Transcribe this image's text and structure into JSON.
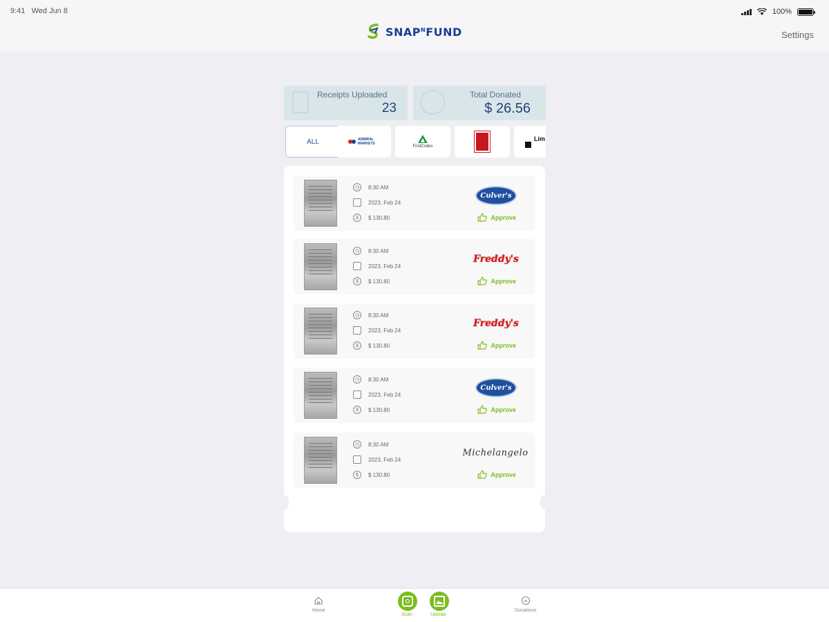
{
  "status_bar": {
    "time": "9:41",
    "date": "Wed Jun 8",
    "battery": "100%"
  },
  "header": {
    "app_name": "SNAP",
    "app_name_small": "N",
    "app_name_end": "FUND",
    "settings_label": "Settings",
    "brand_color": "#1c3f92",
    "accent_color": "#7cbc21"
  },
  "stats": {
    "receipts_label": "Receipts Uploaded",
    "receipts_value": "23",
    "donated_label": "Total Donated",
    "donated_value": "$ 26.56"
  },
  "filters": [
    {
      "label": "ALL",
      "selected": true
    },
    {
      "label": "ADMIRAL MARKETS",
      "icon": "admiral-markets-logo"
    },
    {
      "label": "FirstCodes",
      "icon": "firstcodes-logo"
    },
    {
      "label": "",
      "icon": "red-badge-logo"
    },
    {
      "label": "Lim",
      "icon": "lim-logo"
    }
  ],
  "receipts": [
    {
      "time": "8:30 AM",
      "date": "2023, Feb 24",
      "amount": "$ 130.80",
      "brand": "Culver's",
      "status": "Approve"
    },
    {
      "time": "8:30 AM",
      "date": "2023, Feb 24",
      "amount": "$ 130.80",
      "brand": "Freddy's",
      "status": "Approve"
    },
    {
      "time": "8:30 AM",
      "date": "2023, Feb 24",
      "amount": "$ 130.80",
      "brand": "Freddy's",
      "status": "Approve"
    },
    {
      "time": "8:30 AM",
      "date": "2023, Feb 24",
      "amount": "$ 130.80",
      "brand": "Culver's",
      "status": "Approve"
    },
    {
      "time": "8:30 AM",
      "date": "2023, Feb 24",
      "amount": "$ 130.80",
      "brand": "Michelangelo",
      "status": "Approve"
    }
  ],
  "bottom_nav": {
    "home": "Home",
    "scan": "Scan",
    "upload": "Upload",
    "donations": "Donations"
  }
}
